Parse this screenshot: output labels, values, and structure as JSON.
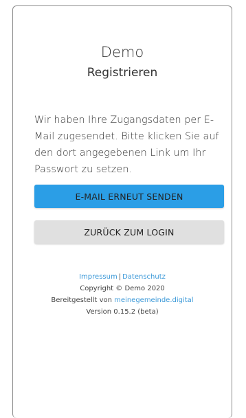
{
  "app": {
    "title": "Demo",
    "subtitle": "Registrieren"
  },
  "message": "Wir haben Ihre Zugangsdaten per E-Mail zugesendet. Bitte klicken Sie auf den dort angegebenen Link um Ihr Passwort zu setzen.",
  "buttons": {
    "resend_label": "E-MAIL ERNEUT SENDEN",
    "back_label": "ZURÜCK ZUM LOGIN"
  },
  "footer": {
    "impressum": "Impressum",
    "separator": "|",
    "datenschutz": "Datenschutz",
    "copyright": "Copyright © Demo 2020",
    "provided_by_prefix": "Bereitgestellt von ",
    "provided_by_link": "meinegemeinde.digital",
    "version": "Version 0.15.2 (beta)"
  },
  "colors": {
    "primary": "#2b9ee6",
    "secondary": "#e0e0e0",
    "link": "#3a98d8"
  }
}
